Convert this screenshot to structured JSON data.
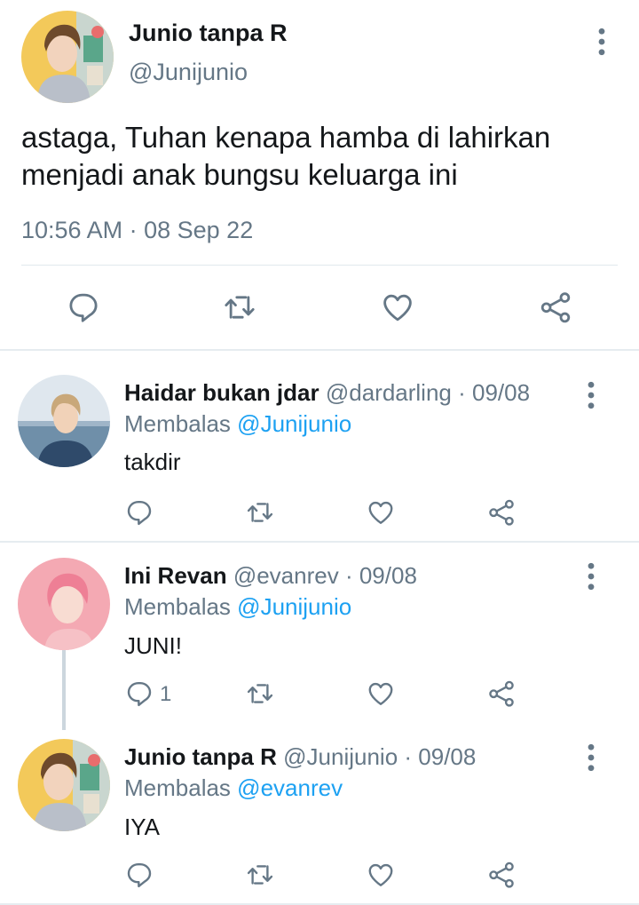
{
  "main_tweet": {
    "author_name": "Junio tanpa R",
    "author_handle": "@Junijunio",
    "text": "astaga, Tuhan kenapa hamba di lahirkan menjadi anak bungsu keluarga ini",
    "time": "10:56 AM",
    "separator": "·",
    "date": "08 Sep 22",
    "avatar": "avatar-boy-yellow-bg",
    "actions": [
      "reply-icon",
      "retweet-icon",
      "like-icon",
      "share-icon"
    ]
  },
  "replies": [
    {
      "author_name": "Haidar bukan jdar",
      "author_handle": "@dardarling",
      "date": "· 09/08",
      "replying_label": "Membalas",
      "replying_to": "@Junijunio",
      "text": "takdir",
      "reply_count": "",
      "avatar": "avatar-boy-sea-bg"
    },
    {
      "author_name": "Ini Revan",
      "author_handle": "@evanrev",
      "date": "· 09/08",
      "replying_label": "Membalas",
      "replying_to": "@Junijunio",
      "text": "JUNI!",
      "reply_count": "1",
      "avatar": "avatar-boy-pink-bg"
    },
    {
      "author_name": "Junio tanpa R",
      "author_handle": "@Junijunio",
      "date": "· 09/08",
      "replying_label": "Membalas",
      "replying_to": "@evanrev",
      "text": "IYA",
      "reply_count": "",
      "avatar": "avatar-boy-yellow-bg"
    }
  ],
  "colors": {
    "text": "#14171a",
    "secondary": "#657786",
    "mention": "#1da1f2",
    "divider": "#e1e8ed",
    "thread_line": "#ccd6dd"
  }
}
